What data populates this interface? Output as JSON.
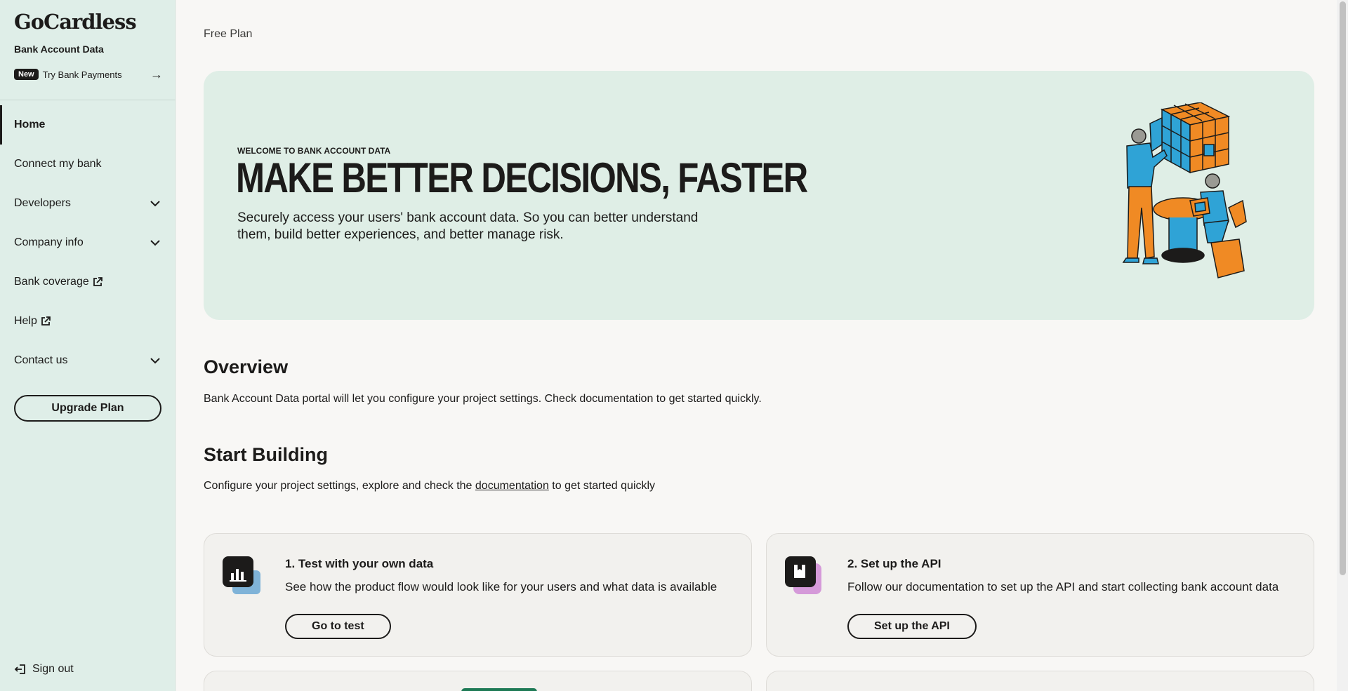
{
  "sidebar": {
    "logo": "GoCardless",
    "product": "Bank Account Data",
    "new_badge": "New",
    "try_label": "Try Bank Payments",
    "nav": {
      "home": "Home",
      "connect": "Connect my bank",
      "developers": "Developers",
      "company": "Company info",
      "coverage": "Bank coverage",
      "help": "Help",
      "contact": "Contact us"
    },
    "upgrade": "Upgrade Plan",
    "signout": "Sign out"
  },
  "main": {
    "plan": "Free Plan",
    "hero": {
      "eyebrow": "WELCOME TO BANK ACCOUNT DATA",
      "title": "MAKE BETTER DECISIONS, FASTER",
      "subtitle": "Securely access your users' bank account data. So you can better understand them, build better experiences, and better manage risk."
    },
    "overview": {
      "heading": "Overview",
      "text": "Bank Account Data portal will let you configure your project settings. Check documentation to get started quickly."
    },
    "start": {
      "heading": "Start Building",
      "text_before": "Configure your project settings, explore and check the ",
      "link": "documentation",
      "text_after": " to get started quickly"
    },
    "cards": [
      {
        "title": "1. Test with your own data",
        "desc": "See how the product flow would look like for your users and what data is available",
        "button": "Go to test"
      },
      {
        "title": "2. Set up the API",
        "desc": "Follow our documentation to set up the API and start collecting bank account data",
        "button": "Set up the API"
      }
    ]
  },
  "colors": {
    "sidebar_bg": "#dfeee8",
    "hero_bg": "#dfeee6",
    "page_bg": "#f8f7f5",
    "text": "#1c1b1a",
    "accent_green": "#1e7a55",
    "illus_orange": "#f08a24",
    "illus_blue": "#2fa3d6"
  }
}
